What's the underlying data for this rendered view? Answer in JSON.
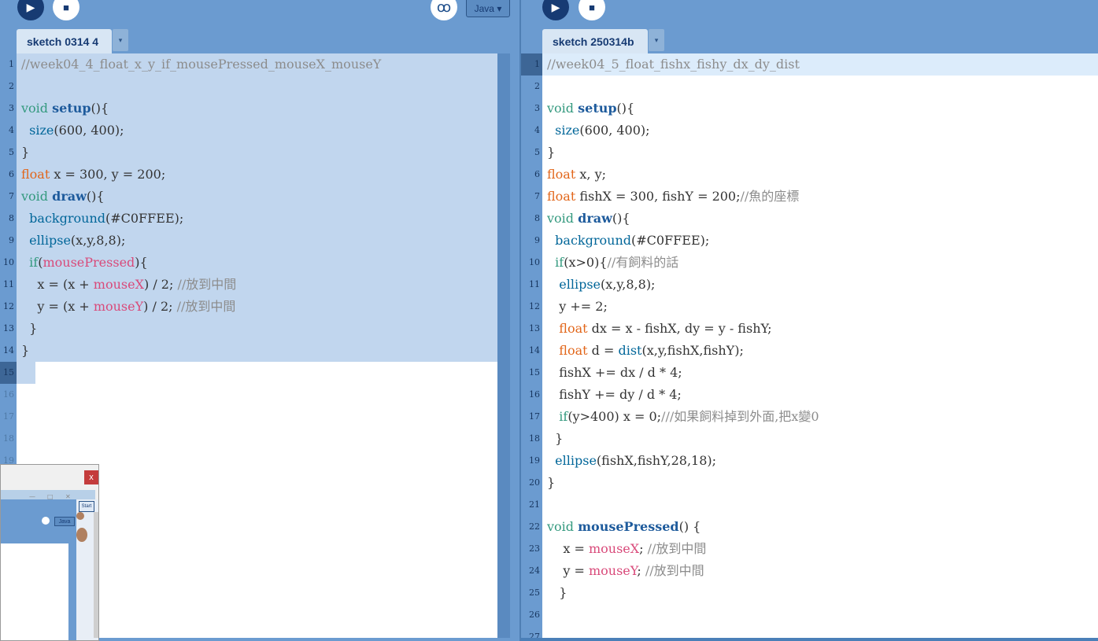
{
  "left": {
    "tab_title": "sketch 0314 4",
    "mode": "Java",
    "debug_symbol": "ꝏ",
    "run_symbol": "▶",
    "stop_symbol": "■",
    "menu_symbol": "▾",
    "line_numbers": [
      "1",
      "2",
      "3",
      "4",
      "5",
      "6",
      "7",
      "8",
      "9",
      "10",
      "11",
      "12",
      "13",
      "14",
      "15",
      "16",
      "17",
      "18",
      "19"
    ],
    "current_line": "15"
  },
  "right": {
    "tab_title": "sketch 250314b",
    "run_symbol": "▶",
    "stop_symbol": "■",
    "menu_symbol": "▾",
    "line_numbers": [
      "1",
      "2",
      "3",
      "4",
      "5",
      "6",
      "7",
      "8",
      "9",
      "10",
      "11",
      "12",
      "13",
      "14",
      "15",
      "16",
      "17",
      "18",
      "19",
      "20",
      "21",
      "22",
      "23",
      "24",
      "25",
      "26",
      "27"
    ],
    "current_line": "1"
  },
  "popup": {
    "close_symbol": "x",
    "mode": "Java",
    "start_label": "Start"
  }
}
